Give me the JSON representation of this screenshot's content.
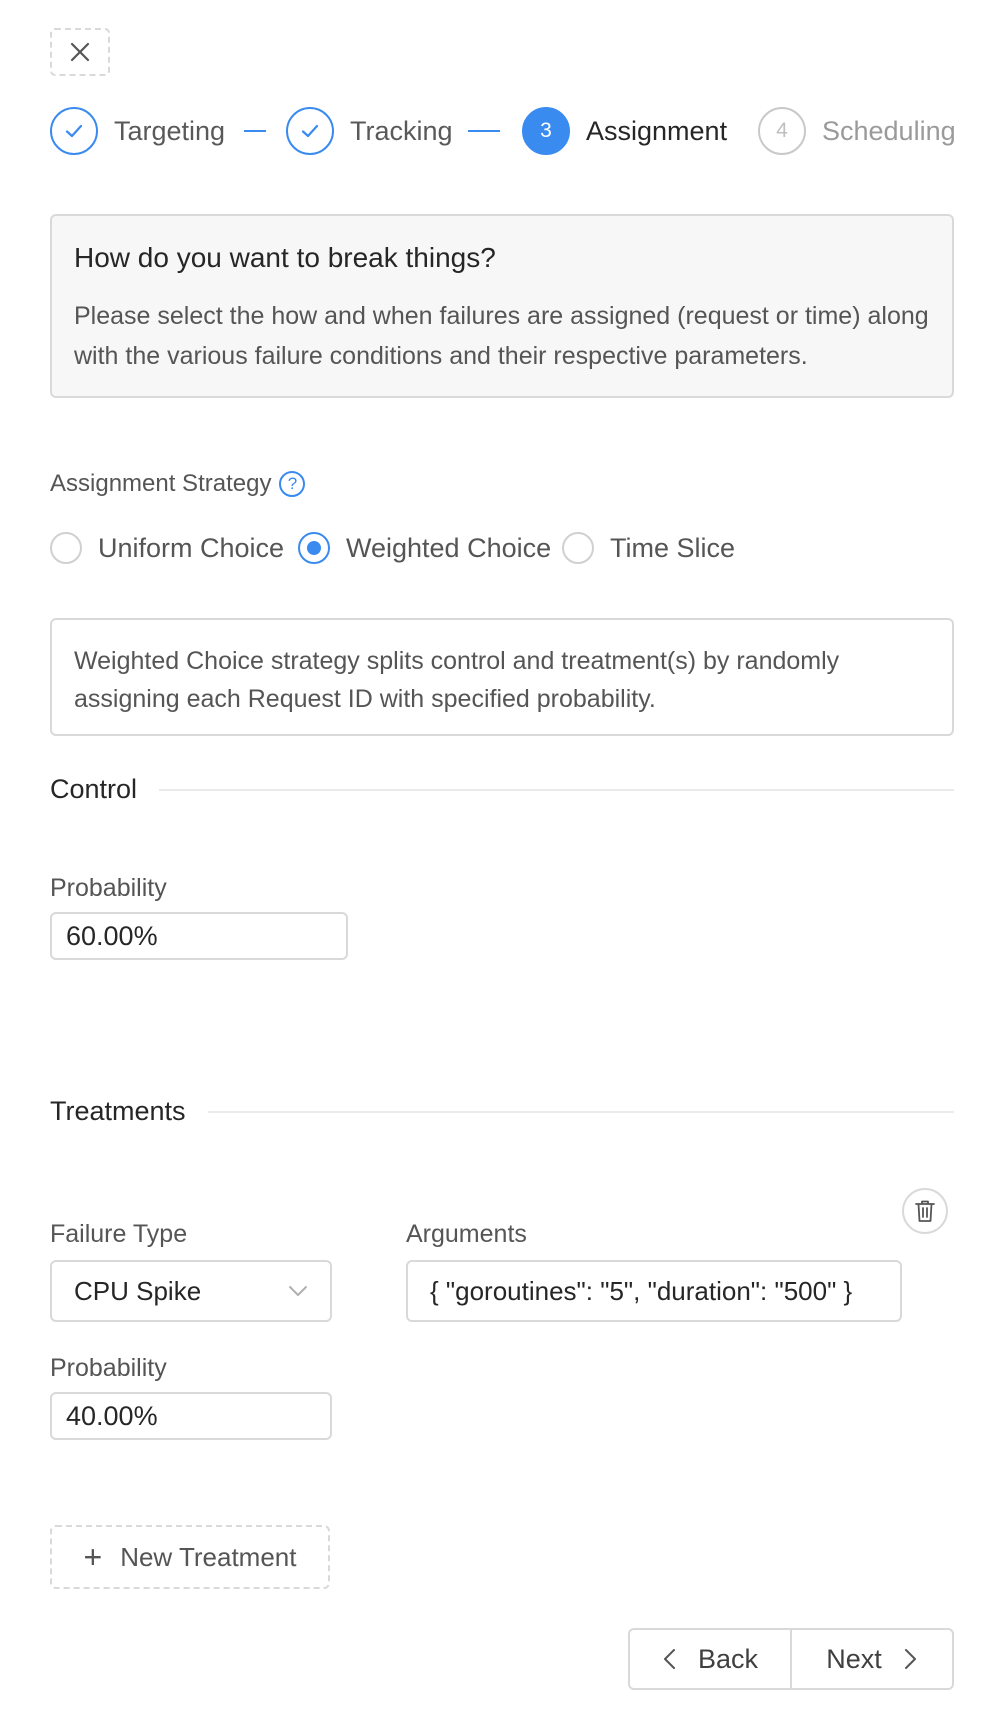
{
  "header": {
    "close_icon": "close-icon"
  },
  "steps": [
    {
      "number": "1",
      "title": "Targeting",
      "status": "finished"
    },
    {
      "number": "2",
      "title": "Tracking",
      "status": "finished"
    },
    {
      "number": "3",
      "title": "Assignment",
      "status": "active"
    },
    {
      "number": "4",
      "title": "Scheduling",
      "status": "waiting"
    }
  ],
  "intro": {
    "title": "How do you want to break things?",
    "text": "Please select the how and when failures are assigned (request or time) along with the various failure conditions and their respective parameters."
  },
  "strategy": {
    "label": "Assignment Strategy",
    "help_icon": "?",
    "options": [
      {
        "label": "Uniform Choice",
        "checked": false
      },
      {
        "label": "Weighted Choice",
        "checked": true
      },
      {
        "label": "Time Slice",
        "checked": false
      }
    ],
    "description": "Weighted Choice strategy splits control and treatment(s) by randomly assigning each Request ID with specified probability."
  },
  "control": {
    "heading": "Control",
    "probability_label": "Probability",
    "probability_value": "60.00%"
  },
  "treatments": {
    "heading": "Treatments",
    "items": [
      {
        "failure_type_label": "Failure Type",
        "failure_type_value": "CPU Spike",
        "arguments_label": "Arguments",
        "arguments_value": "{ \"goroutines\": \"5\", \"duration\": \"500\" }",
        "probability_label": "Probability",
        "probability_value": "40.00%"
      }
    ],
    "new_button_label": "New Treatment"
  },
  "footer": {
    "back_label": "Back",
    "next_label": "Next"
  },
  "colors": {
    "primary": "#3a8bf0",
    "border": "#d9d9d9",
    "intro_bg": "#f7f7f7"
  }
}
